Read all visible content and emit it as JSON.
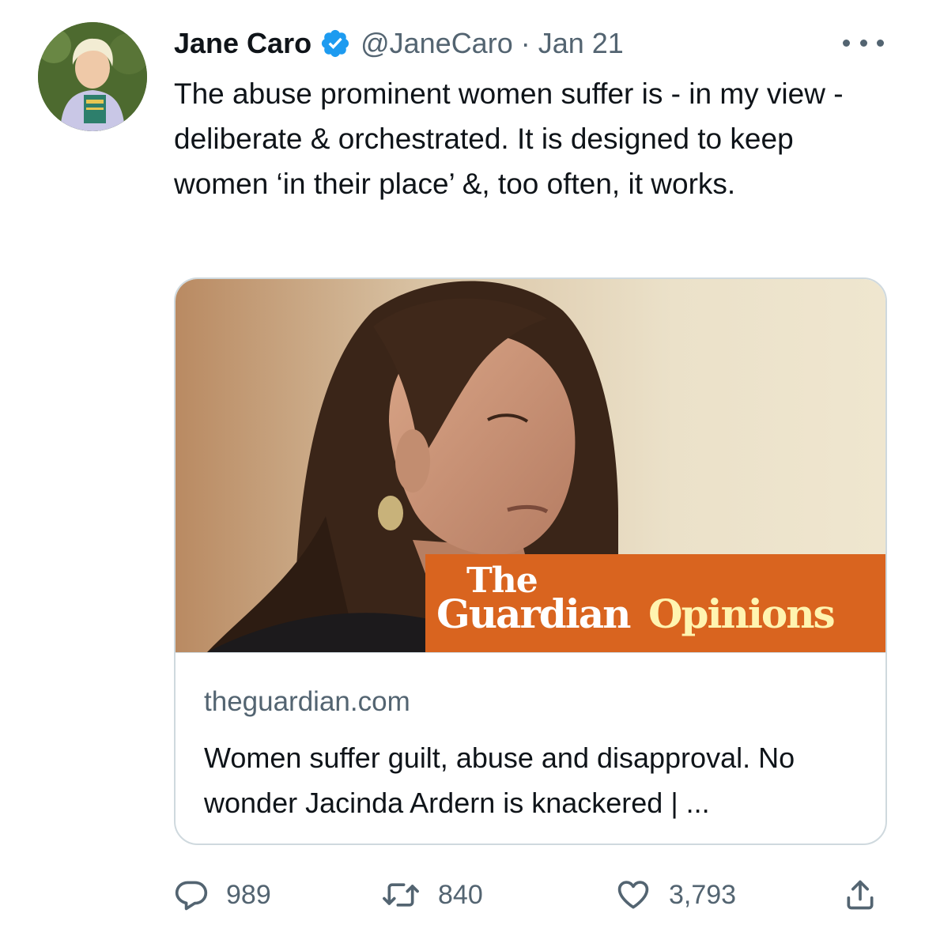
{
  "tweet": {
    "author_name": "Jane Caro",
    "handle": "@JaneCaro",
    "separator": "·",
    "date": "Jan 21",
    "text": "The abuse prominent women suffer is - in my view - deliberate & orchestrated. It is designed to keep women ‘in their place’ &, too often, it works.",
    "verified_icon": "verified-badge-icon",
    "more_icon": "more-options-icon"
  },
  "card": {
    "brand_the": "The",
    "brand_guardian": "Guardian",
    "brand_opinions": "Opinions",
    "domain": "theguardian.com",
    "title": "Women suffer guilt, abuse and disapproval. No wonder Jacinda Ardern is knackered | ..."
  },
  "actions": {
    "replies": "989",
    "retweets": "840",
    "likes": "3,793",
    "reply_icon": "reply-icon",
    "retweet_icon": "retweet-icon",
    "like_icon": "heart-icon",
    "share_icon": "share-icon"
  },
  "colors": {
    "verified_blue": "#1d9bf0",
    "muted_text": "#536471",
    "brand_orange": "#d9641f"
  }
}
